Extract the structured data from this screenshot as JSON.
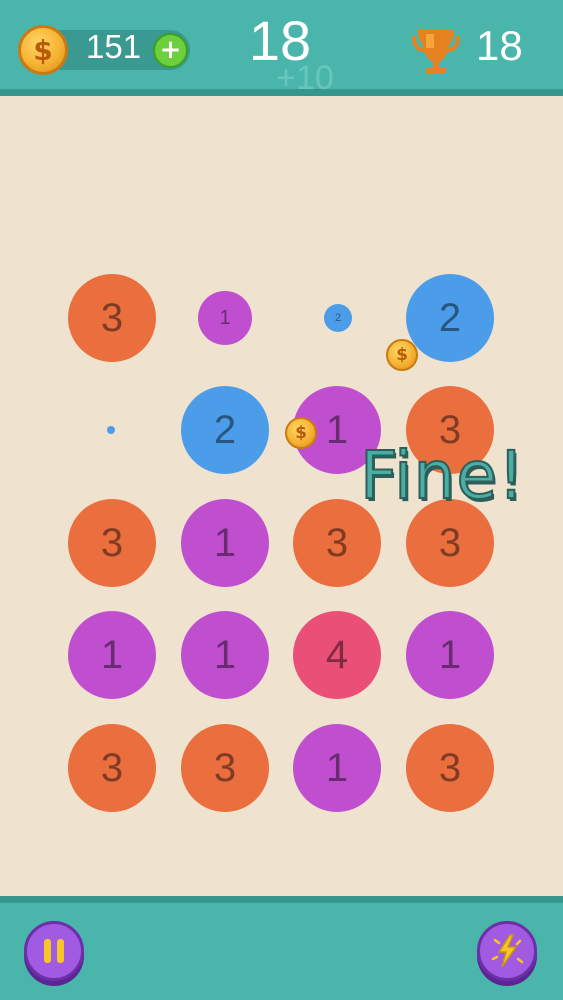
{
  "header": {
    "coins": "151",
    "coin_symbol": "$",
    "add_coins_label": "+",
    "score": "18",
    "score_bonus": "+10",
    "best_score": "18"
  },
  "feedback": {
    "text": "Fine!"
  },
  "board": {
    "rows": [
      [
        "3",
        "1",
        "2",
        "2"
      ],
      [
        "",
        "2",
        "1",
        "3"
      ],
      [
        "3",
        "1",
        "3",
        "3"
      ],
      [
        "1",
        "1",
        "4",
        "1"
      ],
      [
        "3",
        "3",
        "1",
        "3"
      ]
    ],
    "colors": {
      "1": "#c04fd0",
      "2": "#4b9de9",
      "3": "#ea6e3e",
      "4": "#ea4f77"
    }
  },
  "board_coin_symbol": "$",
  "colors": {
    "bar": "#4ab5ab",
    "background": "#efe3d0",
    "button": "#a15be3"
  }
}
